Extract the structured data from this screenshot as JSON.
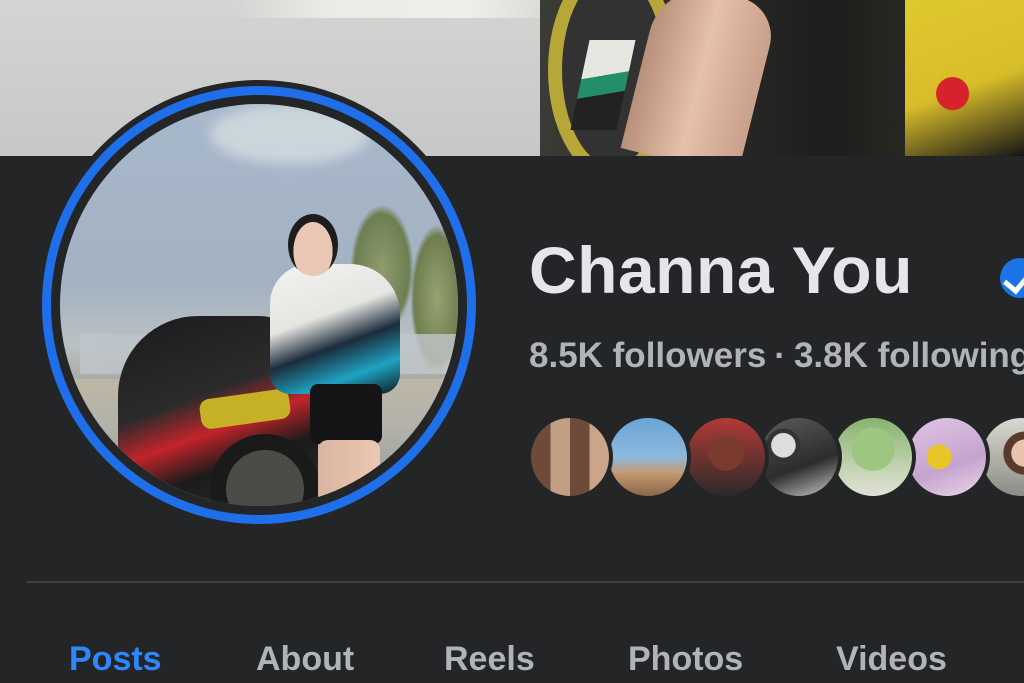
{
  "profile": {
    "name": "Channa You",
    "verified": true,
    "followers": "8.5K followers",
    "separator": "·",
    "following": "3.8K following"
  },
  "friends": {
    "avatars": [
      "friend-avatar",
      "friend-avatar",
      "friend-avatar",
      "friend-avatar",
      "friend-avatar",
      "friend-avatar",
      "friend-avatar"
    ]
  },
  "tabs": [
    {
      "label": "Posts",
      "active": true
    },
    {
      "label": "About",
      "active": false
    },
    {
      "label": "Reels",
      "active": false
    },
    {
      "label": "Photos",
      "active": false
    },
    {
      "label": "Videos",
      "active": false
    }
  ],
  "colors": {
    "background": "#242526",
    "accent": "#2d88ff",
    "avatar_ring": "#1f6feb",
    "text_primary": "#e4e6eb",
    "text_secondary": "#b0b3b8"
  },
  "icons": {
    "verified": "verified-badge-icon"
  }
}
